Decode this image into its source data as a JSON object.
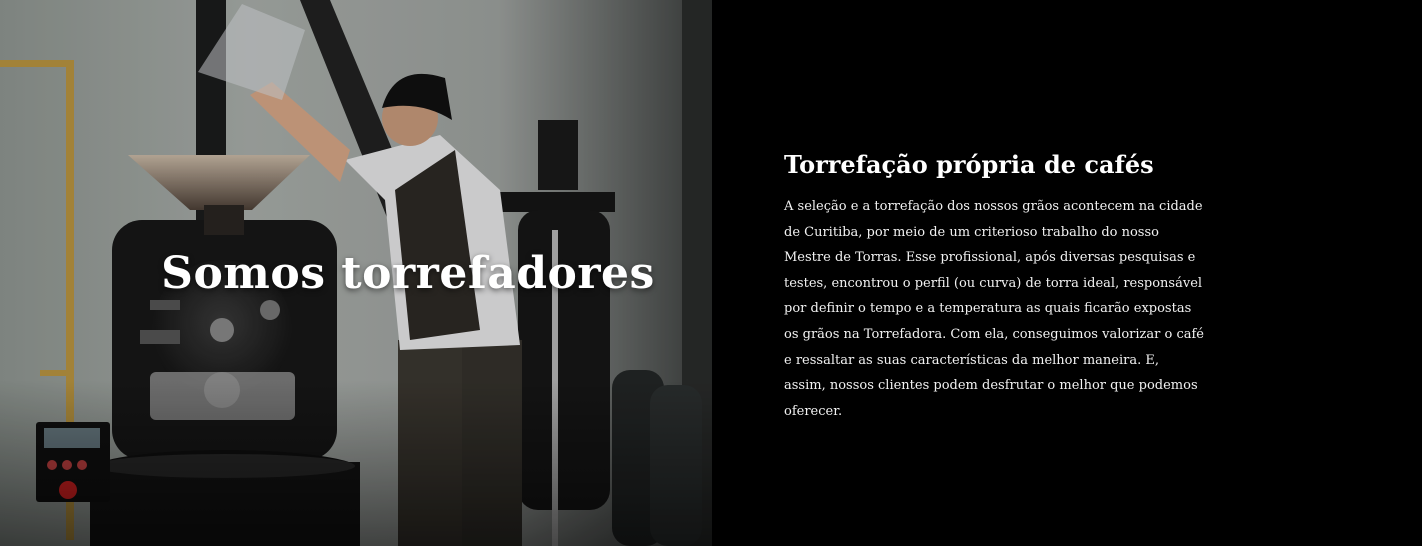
{
  "hero": {
    "title": "Somos torrefadores",
    "image_description_icon": "roaster-photo"
  },
  "about": {
    "heading": "Torrefação própria de cafés",
    "paragraph": "A seleção e a torrefação dos nossos grãos acontecem na cidade de Curitiba, por meio de um criterioso trabalho do nosso Mestre de Torras. Esse profissional, após diversas pesquisas e testes, encontrou o perfil (ou curva) de torra ideal, responsável por definir o tempo e a temperatura as quais ficarão expostas os grãos na Torrefadora. Com ela, conseguimos valorizar o café e ressaltar as suas características da melhor maneira. E, assim, nossos clientes podem desfrutar o melhor que podemos oferecer."
  },
  "colors": {
    "panel_background": "#000000",
    "text": "#ffffff"
  }
}
